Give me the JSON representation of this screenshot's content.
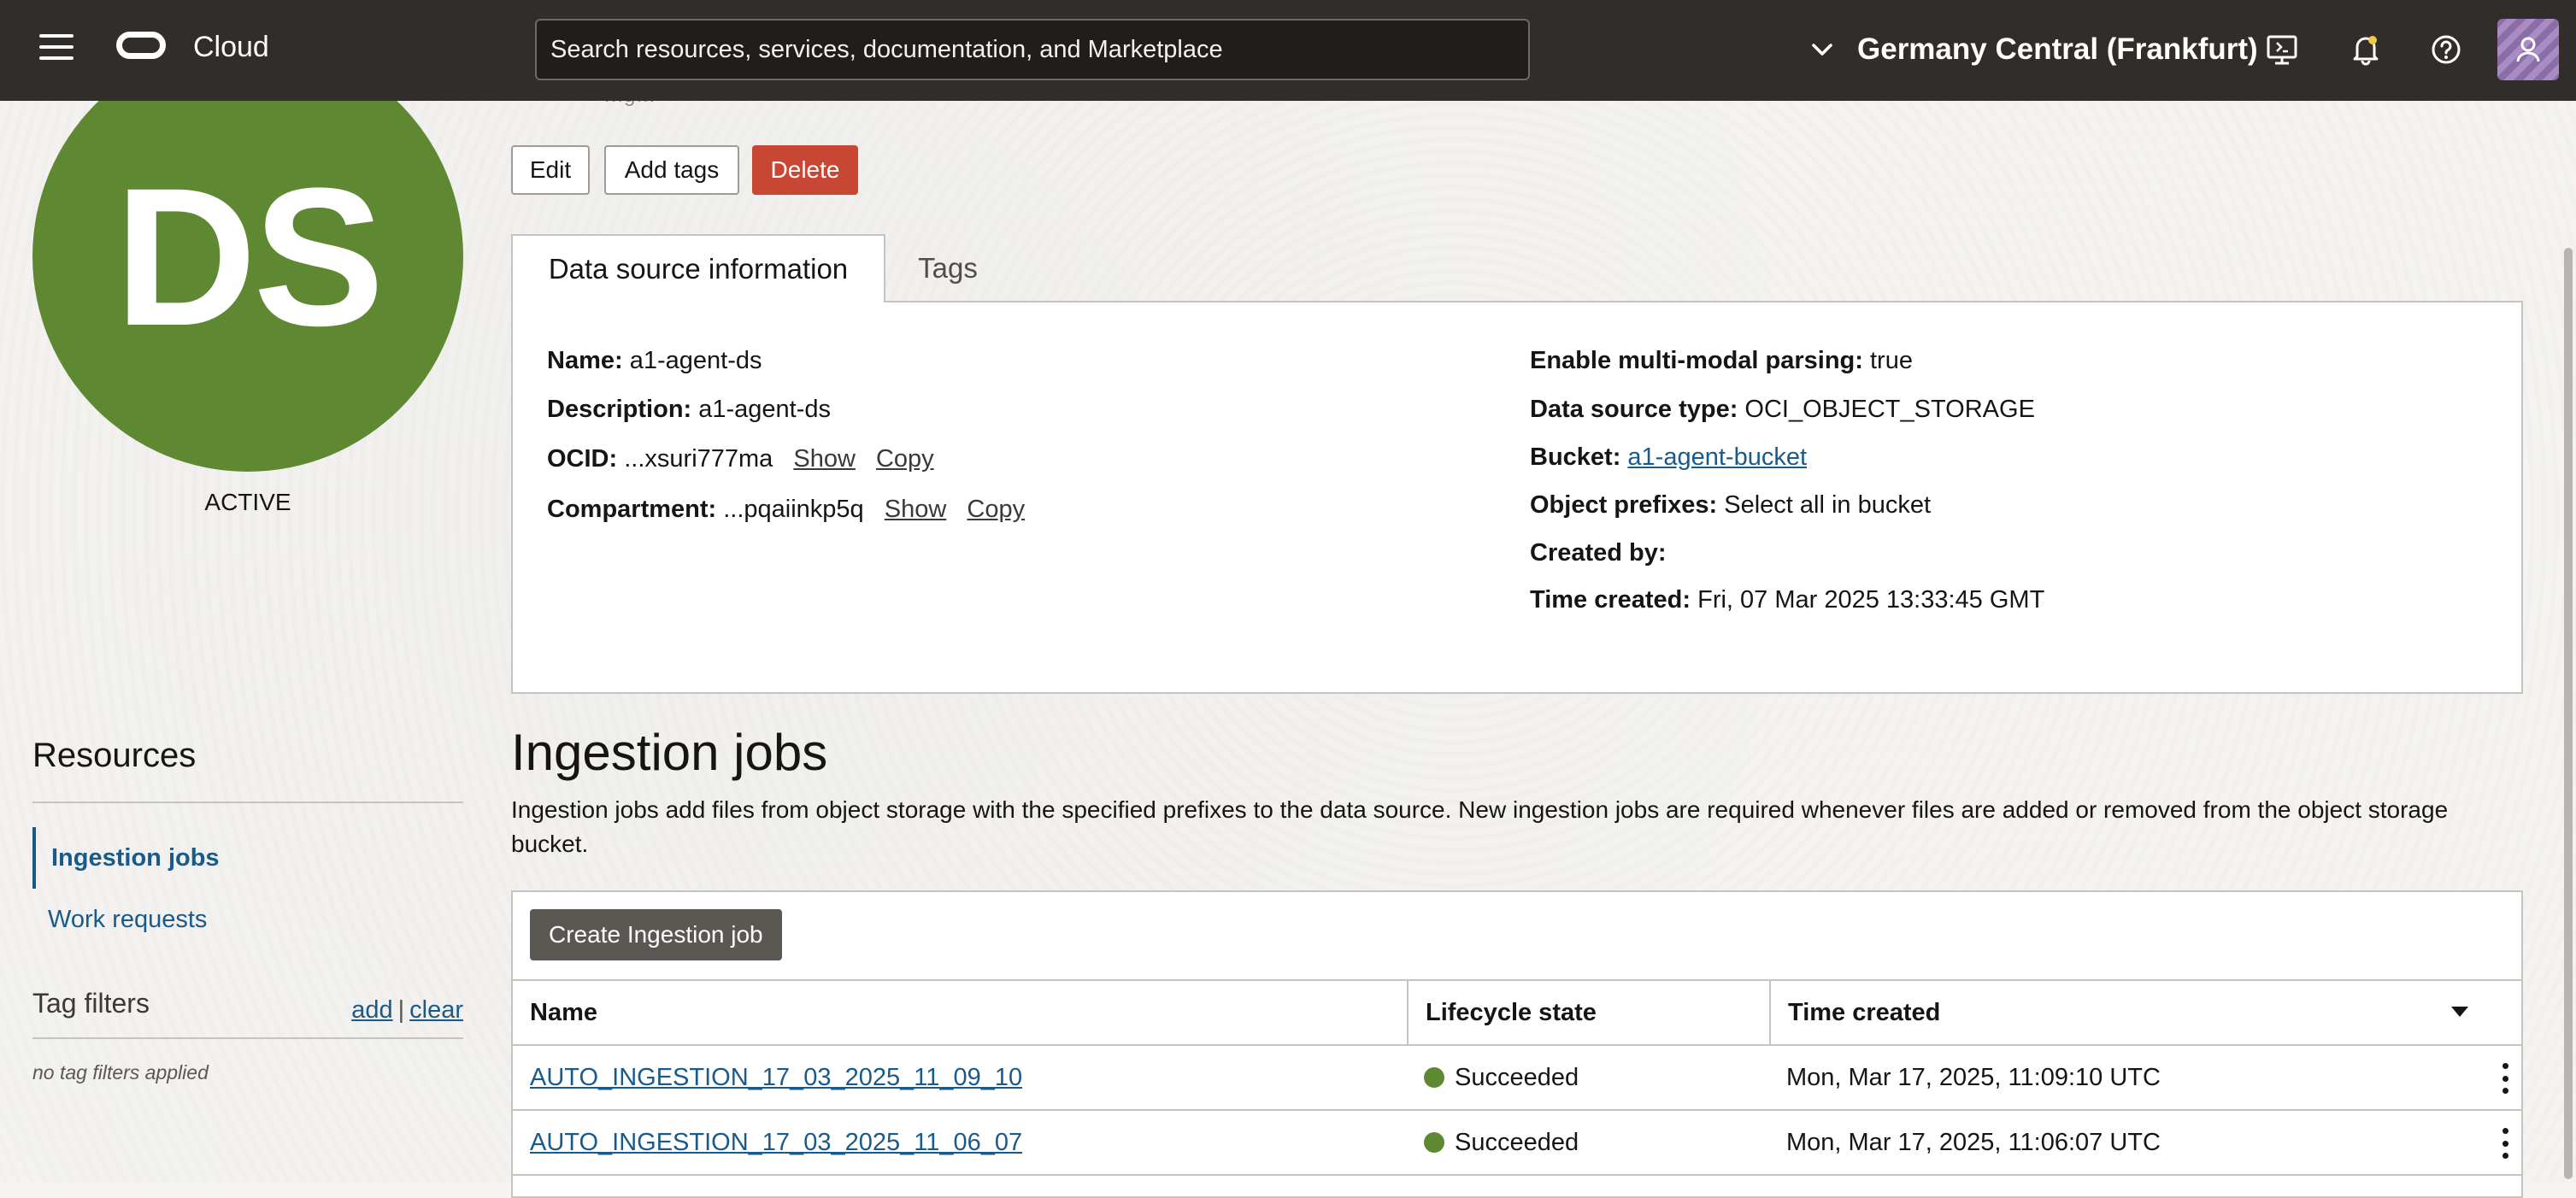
{
  "header": {
    "brand": "Cloud",
    "search_placeholder": "Search resources, services, documentation, and Marketplace",
    "region": "Germany Central (Frankfurt)"
  },
  "resource": {
    "initials": "DS",
    "status": "ACTIVE",
    "partial_text": "…g…"
  },
  "actions": {
    "edit": "Edit",
    "add_tags": "Add tags",
    "delete": "Delete"
  },
  "tabs": {
    "info": "Data source information",
    "tags": "Tags"
  },
  "info": {
    "left": {
      "name_label": "Name:",
      "name_value": "a1-agent-ds",
      "description_label": "Description:",
      "description_value": "a1-agent-ds",
      "ocid_label": "OCID:",
      "ocid_value": "...xsuri777ma",
      "compartment_label": "Compartment:",
      "compartment_value": "...pqaiinkp5q",
      "show": "Show",
      "copy": "Copy"
    },
    "right": {
      "multimodal_label": "Enable multi-modal parsing:",
      "multimodal_value": "true",
      "type_label": "Data source type:",
      "type_value": "OCI_OBJECT_STORAGE",
      "bucket_label": "Bucket:",
      "bucket_value": "a1-agent-bucket",
      "prefixes_label": "Object prefixes:",
      "prefixes_value": "Select all in bucket",
      "created_by_label": "Created by:",
      "time_created_label": "Time created:",
      "time_created_value": "Fri, 07 Mar 2025 13:33:45 GMT"
    }
  },
  "sidebar": {
    "resources_title": "Resources",
    "items": [
      {
        "label": "Ingestion jobs"
      },
      {
        "label": "Work requests"
      }
    ],
    "tag_filters": "Tag filters",
    "tag_add": "add",
    "tag_sep": "|",
    "tag_clear": "clear",
    "tag_empty": "no tag filters applied"
  },
  "ingestion": {
    "title": "Ingestion jobs",
    "description": "Ingestion jobs add files from object storage with the specified prefixes to the data source. New ingestion jobs are required whenever files are added or removed from the object storage bucket.",
    "create_button": "Create Ingestion job",
    "columns": [
      "Name",
      "Lifecycle state",
      "Time created"
    ],
    "rows": [
      {
        "name": "AUTO_INGESTION_17_03_2025_11_09_10",
        "state": "Succeeded",
        "time": "Mon, Mar 17, 2025, 11:09:10 UTC"
      },
      {
        "name": "AUTO_INGESTION_17_03_2025_11_06_07",
        "state": "Succeeded",
        "time": "Mon, Mar 17, 2025, 11:06:07 UTC"
      }
    ]
  },
  "colors": {
    "header_bg": "#312d2a",
    "accent_green": "#5e8932",
    "delete_red": "#c74634",
    "link_blue": "#1a5a8a"
  }
}
